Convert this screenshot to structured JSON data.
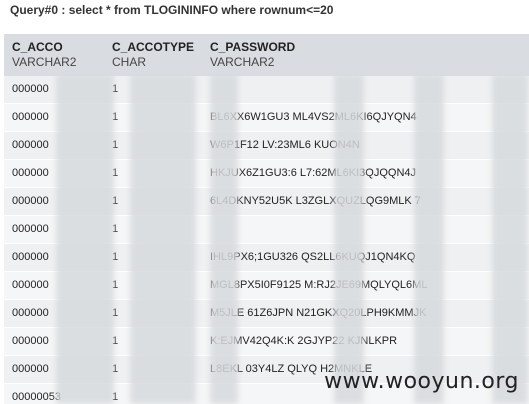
{
  "query": {
    "title": "Query#0 : select * from TLOGININFO where rownum<=20"
  },
  "columns": [
    {
      "name": "C_ACCO",
      "type": "VARCHAR2"
    },
    {
      "name": "C_ACCOTYPE",
      "type": "CHAR"
    },
    {
      "name": "C_PASSWORD",
      "type": "VARCHAR2"
    }
  ],
  "rows": [
    {
      "acco": "000000",
      "type": "1",
      "password": ""
    },
    {
      "acco": "000000",
      "type": "1",
      "password": "BL6XX6W1GU3  ML4VS2ML6KI6QJYQN4"
    },
    {
      "acco": "000000",
      "type": "1",
      "password": "W6P1F12  LV:23ML6   KUON4N"
    },
    {
      "acco": "000000",
      "type": "1",
      "password": "HKJUX6Z1GU3:6  L7:62ML6KI3QJQQN4J"
    },
    {
      "acco": "000000",
      "type": "1",
      "password": "6L4DKNY52U5K  L3ZGLXQUZLQG9MLK  7"
    },
    {
      "acco": "000000",
      "type": "1",
      "password": ""
    },
    {
      "acco": "000000",
      "type": "1",
      "password": "IHL9PX6;1GU326  QS2LL6KUQJ1QN4KQ"
    },
    {
      "acco": "000000",
      "type": "1",
      "password": "MGL8PX5I0F9125  M:RJ2JE69MQLYQL6ML"
    },
    {
      "acco": "000000",
      "type": "1",
      "password": "M5JLE  61Z6JPN  N21GKXQ20LPH9KMMJK"
    },
    {
      "acco": "000000",
      "type": "1",
      "password": "K:EJMV42Q4K:K  2GJYP22  KJNLKPR"
    },
    {
      "acco": "000000",
      "type": "1",
      "password": "L8EKL  03Y4LZ  QLYQ  H2MNKLE"
    },
    {
      "acco": "00000053",
      "type": "1",
      "password": ""
    }
  ],
  "watermark": {
    "text": "www.wooyun.org"
  }
}
